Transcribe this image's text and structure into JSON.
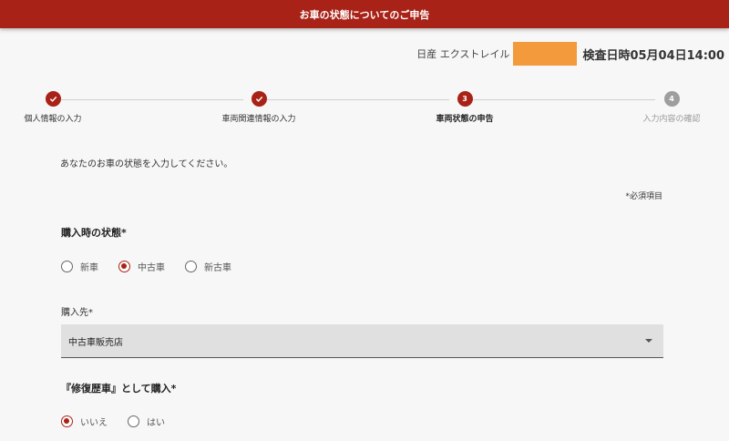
{
  "header": {
    "title": "お車の状態についてのご申告"
  },
  "vehicle": {
    "name": "日産 エクストレイル",
    "inspection": "検査日時05月04日14:00"
  },
  "colors": {
    "accent": "#a82217",
    "redaction": "#f29a3c",
    "pending": "#9e9e9e"
  },
  "stepper": {
    "steps": [
      {
        "num": "1",
        "label": "個人情報の入力",
        "state": "done",
        "icon": "check-icon"
      },
      {
        "num": "2",
        "label": "車両関連情報の入力",
        "state": "done",
        "icon": "check-icon"
      },
      {
        "num": "3",
        "label": "車両状態の申告",
        "state": "active"
      },
      {
        "num": "4",
        "label": "入力内容の確認",
        "state": "pending"
      }
    ]
  },
  "form": {
    "instruction": "あなたのお車の状態を入力してください。",
    "required_note": "*必須項目",
    "purchase_state": {
      "label": "購入時の状態*",
      "options": [
        "新車",
        "中古車",
        "新古車"
      ],
      "selected": "中古車"
    },
    "purchase_from": {
      "label": "購入先*",
      "value": "中古車販売店"
    },
    "repair_history": {
      "label": "『修復歴車』として購入*",
      "options": [
        "いいえ",
        "はい"
      ],
      "selected": "いいえ"
    }
  }
}
